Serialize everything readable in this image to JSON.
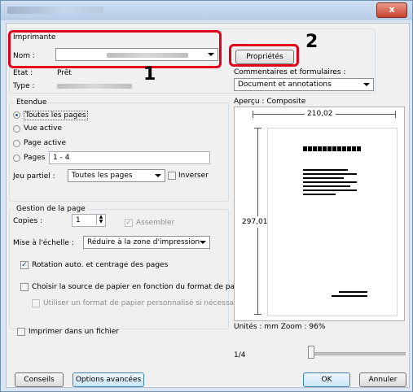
{
  "window": {
    "close_label": "x"
  },
  "printer": {
    "group_label": "Imprimante",
    "name_label": "Nom :",
    "status_label": "Etat :",
    "status_value": "Prêt",
    "type_label": "Type :",
    "properties_button": "Propriétés",
    "comments_label": "Commentaires et formulaires :",
    "comments_value": "Document et annotations"
  },
  "callouts": {
    "one": "1",
    "two": "2"
  },
  "range": {
    "group_label": "Etendue",
    "all_pages": "Toutes les pages",
    "current_view": "Vue active",
    "current_page": "Page active",
    "pages_label": "Pages",
    "pages_value": "1 - 4",
    "subset_label": "Jeu partiel :",
    "subset_value": "Toutes les pages",
    "reverse_label": "Inverser"
  },
  "handling": {
    "group_label": "Gestion de la page",
    "copies_label": "Copies :",
    "copies_value": "1",
    "collate_label": "Assembler",
    "scaling_label": "Mise à l'échelle :",
    "scaling_value": "Réduire à la zone d'impression",
    "auto_rotate_label": "Rotation auto. et centrage des pages",
    "paper_source_label": "Choisir la source de papier en fonction du format de page",
    "custom_paper_label": "Utiliser un format de papier personnalisé si nécessaire"
  },
  "print_to_file_label": "Imprimer dans un fichier",
  "preview": {
    "title": "Aperçu : Composite",
    "width_value": "210,02",
    "height_value": "297,01",
    "units_zoom": "Unités : mm Zoom :  96%",
    "page_indicator": "1/4",
    "slider_level": 0
  },
  "footer": {
    "tips_button": "Conseils",
    "advanced_button": "Options avancées",
    "ok_button": "OK",
    "cancel_button": "Annuler"
  }
}
